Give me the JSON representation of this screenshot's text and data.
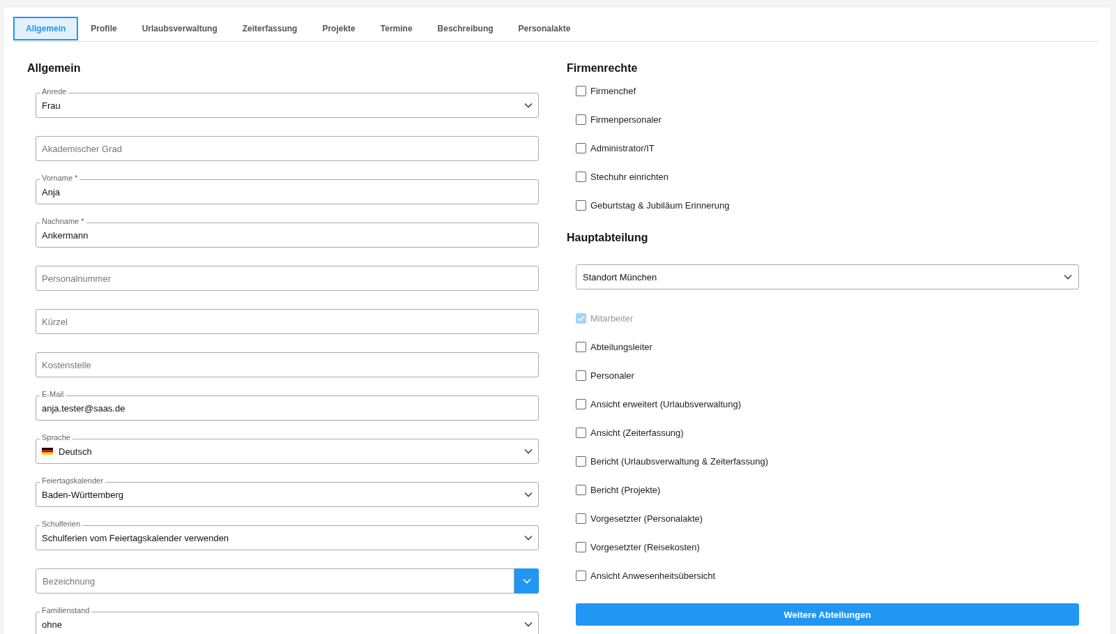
{
  "tabs": [
    {
      "label": "Allgemein",
      "selected": true
    },
    {
      "label": "Profile",
      "selected": false
    },
    {
      "label": "Urlaubsverwaltung",
      "selected": false
    },
    {
      "label": "Zeiterfassung",
      "selected": false
    },
    {
      "label": "Projekte",
      "selected": false
    },
    {
      "label": "Termine",
      "selected": false
    },
    {
      "label": "Beschreibung",
      "selected": false
    },
    {
      "label": "Personalakte",
      "selected": false
    }
  ],
  "general": {
    "title": "Allgemein",
    "fields": [
      {
        "kind": "select",
        "label": "Anrede",
        "value": "Frau"
      },
      {
        "kind": "text",
        "placeholder": "Akademischer Grad"
      },
      {
        "kind": "text",
        "label": "Vorname *",
        "value": "Anja"
      },
      {
        "kind": "text",
        "label": "Nachname *",
        "value": "Ankermann"
      },
      {
        "kind": "text",
        "placeholder": "Personalnummer"
      },
      {
        "kind": "text",
        "placeholder": "Kürzel"
      },
      {
        "kind": "text",
        "placeholder": "Kostenstelle"
      },
      {
        "kind": "text",
        "label": "E-Mail",
        "value": "anja.tester@saas.de"
      },
      {
        "kind": "flag-select",
        "label": "Sprache",
        "value": "Deutsch"
      },
      {
        "kind": "select",
        "label": "Feiertagskalender",
        "value": "Baden-Württemberg"
      },
      {
        "kind": "select",
        "label": "Schulferien",
        "value": "Schulferien vom Feiertagskalender verwenden"
      },
      {
        "kind": "combo",
        "placeholder": "Bezeichnung"
      },
      {
        "kind": "select",
        "label": "Familienstand",
        "value": "ohne"
      }
    ]
  },
  "company_rights": {
    "title": "Firmenrechte",
    "items": [
      {
        "label": "Firmenchef",
        "checked": false,
        "disabled": false
      },
      {
        "label": "Firmenpersonaler",
        "checked": false,
        "disabled": false
      },
      {
        "label": "Administrator/IT",
        "checked": false,
        "disabled": false
      },
      {
        "label": "Stechuhr einrichten",
        "checked": false,
        "disabled": false
      },
      {
        "label": "Geburtstag & Jubiläum Erinnerung",
        "checked": false,
        "disabled": false
      }
    ]
  },
  "main_department": {
    "title": "Hauptabteilung",
    "select": {
      "value": "Standort München"
    },
    "items": [
      {
        "label": "Mitarbeiter",
        "checked": true,
        "disabled": true
      },
      {
        "label": "Abteilungsleiter",
        "checked": false,
        "disabled": false
      },
      {
        "label": "Personaler",
        "checked": false,
        "disabled": false
      },
      {
        "label": "Ansicht erweitert (Urlaubsverwaltung)",
        "checked": false,
        "disabled": false
      },
      {
        "label": "Ansicht (Zeiterfassung)",
        "checked": false,
        "disabled": false
      },
      {
        "label": "Bericht (Urlaubsverwaltung & Zeiterfassung)",
        "checked": false,
        "disabled": false
      },
      {
        "label": "Bericht (Projekte)",
        "checked": false,
        "disabled": false
      },
      {
        "label": "Vorgesetzter (Personalakte)",
        "checked": false,
        "disabled": false
      },
      {
        "label": "Vorgesetzter (Reisekosten)",
        "checked": false,
        "disabled": false
      },
      {
        "label": "Ansicht Anwesenheitsübersicht",
        "checked": false,
        "disabled": false
      }
    ],
    "button": "Weitere Abteilungen"
  }
}
